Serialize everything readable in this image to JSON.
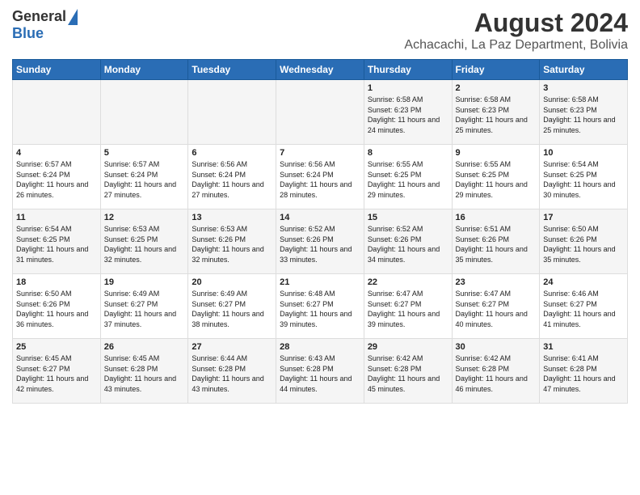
{
  "logo": {
    "general": "General",
    "blue": "Blue"
  },
  "title": "August 2024",
  "subtitle": "Achacachi, La Paz Department, Bolivia",
  "days_of_week": [
    "Sunday",
    "Monday",
    "Tuesday",
    "Wednesday",
    "Thursday",
    "Friday",
    "Saturday"
  ],
  "weeks": [
    [
      {
        "day": "",
        "content": ""
      },
      {
        "day": "",
        "content": ""
      },
      {
        "day": "",
        "content": ""
      },
      {
        "day": "",
        "content": ""
      },
      {
        "day": "1",
        "content": "Sunrise: 6:58 AM\nSunset: 6:23 PM\nDaylight: 11 hours\nand 24 minutes."
      },
      {
        "day": "2",
        "content": "Sunrise: 6:58 AM\nSunset: 6:23 PM\nDaylight: 11 hours\nand 25 minutes."
      },
      {
        "day": "3",
        "content": "Sunrise: 6:58 AM\nSunset: 6:23 PM\nDaylight: 11 hours\nand 25 minutes."
      }
    ],
    [
      {
        "day": "4",
        "content": "Sunrise: 6:57 AM\nSunset: 6:24 PM\nDaylight: 11 hours\nand 26 minutes."
      },
      {
        "day": "5",
        "content": "Sunrise: 6:57 AM\nSunset: 6:24 PM\nDaylight: 11 hours\nand 27 minutes."
      },
      {
        "day": "6",
        "content": "Sunrise: 6:56 AM\nSunset: 6:24 PM\nDaylight: 11 hours\nand 27 minutes."
      },
      {
        "day": "7",
        "content": "Sunrise: 6:56 AM\nSunset: 6:24 PM\nDaylight: 11 hours\nand 28 minutes."
      },
      {
        "day": "8",
        "content": "Sunrise: 6:55 AM\nSunset: 6:25 PM\nDaylight: 11 hours\nand 29 minutes."
      },
      {
        "day": "9",
        "content": "Sunrise: 6:55 AM\nSunset: 6:25 PM\nDaylight: 11 hours\nand 29 minutes."
      },
      {
        "day": "10",
        "content": "Sunrise: 6:54 AM\nSunset: 6:25 PM\nDaylight: 11 hours\nand 30 minutes."
      }
    ],
    [
      {
        "day": "11",
        "content": "Sunrise: 6:54 AM\nSunset: 6:25 PM\nDaylight: 11 hours\nand 31 minutes."
      },
      {
        "day": "12",
        "content": "Sunrise: 6:53 AM\nSunset: 6:25 PM\nDaylight: 11 hours\nand 32 minutes."
      },
      {
        "day": "13",
        "content": "Sunrise: 6:53 AM\nSunset: 6:26 PM\nDaylight: 11 hours\nand 32 minutes."
      },
      {
        "day": "14",
        "content": "Sunrise: 6:52 AM\nSunset: 6:26 PM\nDaylight: 11 hours\nand 33 minutes."
      },
      {
        "day": "15",
        "content": "Sunrise: 6:52 AM\nSunset: 6:26 PM\nDaylight: 11 hours\nand 34 minutes."
      },
      {
        "day": "16",
        "content": "Sunrise: 6:51 AM\nSunset: 6:26 PM\nDaylight: 11 hours\nand 35 minutes."
      },
      {
        "day": "17",
        "content": "Sunrise: 6:50 AM\nSunset: 6:26 PM\nDaylight: 11 hours\nand 35 minutes."
      }
    ],
    [
      {
        "day": "18",
        "content": "Sunrise: 6:50 AM\nSunset: 6:26 PM\nDaylight: 11 hours\nand 36 minutes."
      },
      {
        "day": "19",
        "content": "Sunrise: 6:49 AM\nSunset: 6:27 PM\nDaylight: 11 hours\nand 37 minutes."
      },
      {
        "day": "20",
        "content": "Sunrise: 6:49 AM\nSunset: 6:27 PM\nDaylight: 11 hours\nand 38 minutes."
      },
      {
        "day": "21",
        "content": "Sunrise: 6:48 AM\nSunset: 6:27 PM\nDaylight: 11 hours\nand 39 minutes."
      },
      {
        "day": "22",
        "content": "Sunrise: 6:47 AM\nSunset: 6:27 PM\nDaylight: 11 hours\nand 39 minutes."
      },
      {
        "day": "23",
        "content": "Sunrise: 6:47 AM\nSunset: 6:27 PM\nDaylight: 11 hours\nand 40 minutes."
      },
      {
        "day": "24",
        "content": "Sunrise: 6:46 AM\nSunset: 6:27 PM\nDaylight: 11 hours\nand 41 minutes."
      }
    ],
    [
      {
        "day": "25",
        "content": "Sunrise: 6:45 AM\nSunset: 6:27 PM\nDaylight: 11 hours\nand 42 minutes."
      },
      {
        "day": "26",
        "content": "Sunrise: 6:45 AM\nSunset: 6:28 PM\nDaylight: 11 hours\nand 43 minutes."
      },
      {
        "day": "27",
        "content": "Sunrise: 6:44 AM\nSunset: 6:28 PM\nDaylight: 11 hours\nand 43 minutes."
      },
      {
        "day": "28",
        "content": "Sunrise: 6:43 AM\nSunset: 6:28 PM\nDaylight: 11 hours\nand 44 minutes."
      },
      {
        "day": "29",
        "content": "Sunrise: 6:42 AM\nSunset: 6:28 PM\nDaylight: 11 hours\nand 45 minutes."
      },
      {
        "day": "30",
        "content": "Sunrise: 6:42 AM\nSunset: 6:28 PM\nDaylight: 11 hours\nand 46 minutes."
      },
      {
        "day": "31",
        "content": "Sunrise: 6:41 AM\nSunset: 6:28 PM\nDaylight: 11 hours\nand 47 minutes."
      }
    ]
  ]
}
